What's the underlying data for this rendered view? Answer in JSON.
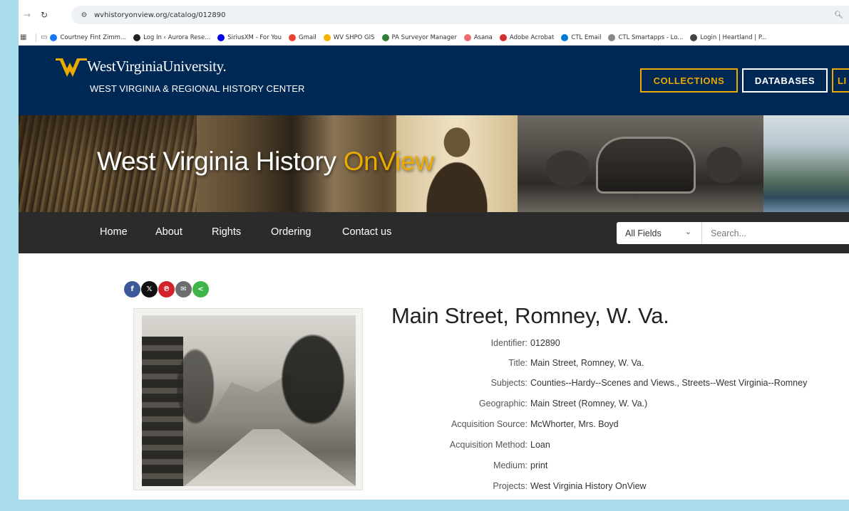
{
  "browser": {
    "url": "wvhistoryonview.org/catalog/012890",
    "bookmarks": [
      {
        "label": "Courtney Fint Zimm...",
        "color": "#1877f2"
      },
      {
        "label": "Log In ‹ Aurora Rese...",
        "color": "#222222"
      },
      {
        "label": "SiriusXM - For You",
        "color": "#0000eb"
      },
      {
        "label": "Gmail",
        "color": "#ea4335"
      },
      {
        "label": "WV SHPO GIS",
        "color": "#f4b400"
      },
      {
        "label": "PA Surveyor Manager",
        "color": "#2e7d32"
      },
      {
        "label": "Asana",
        "color": "#f06a6a"
      },
      {
        "label": "Adobe Acrobat",
        "color": "#d32f2f"
      },
      {
        "label": "CTL Email",
        "color": "#0078d4"
      },
      {
        "label": "CTL Smartapps - Lo...",
        "color": "#888888"
      },
      {
        "label": "Login | Heartland | P...",
        "color": "#444444"
      }
    ]
  },
  "header": {
    "brand": "WestVirginiaUniversity.",
    "subtitle": "WEST VIRGINIA & REGIONAL HISTORY CENTER",
    "buttons": {
      "collections": "COLLECTIONS",
      "databases": "DATABASES",
      "more": "LI"
    }
  },
  "banner": {
    "title_main": "West Virginia History ",
    "title_accent": "OnView"
  },
  "nav": {
    "links": [
      "Home",
      "About",
      "Rights",
      "Ordering",
      "Contact us"
    ],
    "search_field": "All Fields",
    "search_placeholder": "Search..."
  },
  "record": {
    "title": "Main Street, Romney, W. Va.",
    "fields": [
      {
        "label": "Identifier:",
        "value": "012890"
      },
      {
        "label": "Title:",
        "value": "Main Street, Romney, W. Va."
      },
      {
        "label": "Subjects:",
        "value": "Counties--Hardy--Scenes and Views., Streets--West Virginia--Romney"
      },
      {
        "label": "Geographic:",
        "value": "Main Street (Romney, W. Va.)"
      },
      {
        "label": "Acquisition Source:",
        "value": "McWhorter, Mrs. Boyd"
      },
      {
        "label": "Acquisition Method:",
        "value": "Loan"
      },
      {
        "label": "Medium:",
        "value": "print"
      },
      {
        "label": "Projects:",
        "value": "West Virginia History OnView"
      }
    ]
  },
  "colors": {
    "navy": "#002855",
    "gold": "#eaaa00",
    "navbar": "#2b2b2b",
    "frame": "#a9dcea"
  }
}
